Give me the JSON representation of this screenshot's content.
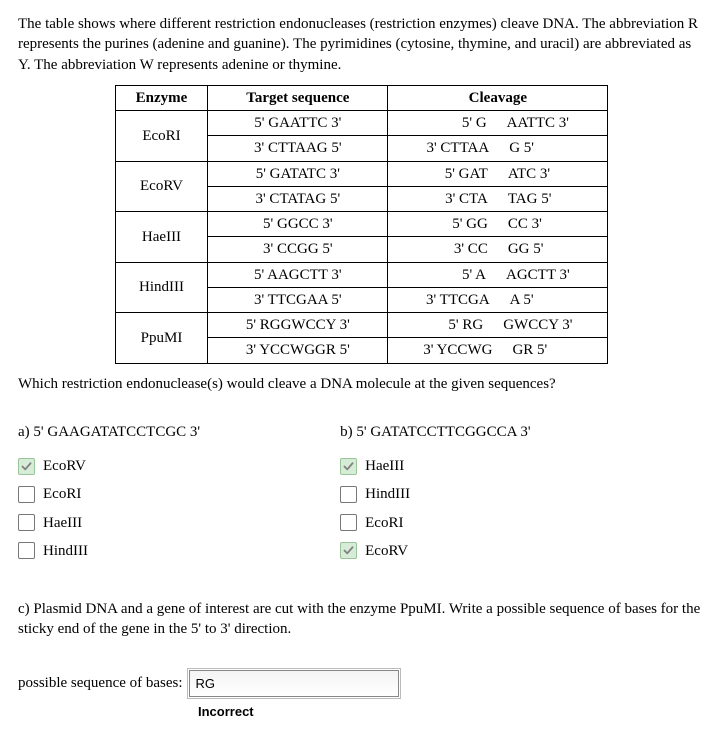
{
  "intro": "The table shows where different restriction endonucleases (restriction enzymes) cleave DNA. The abbreviation R represents the purines (adenine and guanine). The pyrimidines (cytosine, thymine, and uracil) are abbreviated as Y. The abbreviation W represents adenine or thymine.",
  "table": {
    "headers": {
      "enzyme": "Enzyme",
      "target": "Target sequence",
      "cleavage": "Cleavage"
    },
    "rows": [
      {
        "enzyme": "EcoRI",
        "target": [
          "5' GAATTC 3'",
          "3' CTTAAG 5'"
        ],
        "cleave": [
          [
            "5' G",
            "AATTC 3'"
          ],
          [
            "3' CTTAA",
            "G 5'"
          ]
        ]
      },
      {
        "enzyme": "EcoRV",
        "target": [
          "5' GATATC 3'",
          "3' CTATAG 5'"
        ],
        "cleave": [
          [
            "5' GAT",
            "ATC 3'"
          ],
          [
            "3' CTA",
            "TAG 5'"
          ]
        ]
      },
      {
        "enzyme": "HaeIII",
        "target": [
          "5' GGCC 3'",
          "3' CCGG 5'"
        ],
        "cleave": [
          [
            "5' GG",
            "CC 3'"
          ],
          [
            "3' CC",
            "GG 5'"
          ]
        ]
      },
      {
        "enzyme": "HindIII",
        "target": [
          "5' AAGCTT 3'",
          "3' TTCGAA 5'"
        ],
        "cleave": [
          [
            "5' A",
            "AGCTT 3'"
          ],
          [
            "3' TTCGA",
            "A 5'"
          ]
        ]
      },
      {
        "enzyme": "PpuMI",
        "target": [
          "5' RGGWCCY 3'",
          "3' YCCWGGR 5'"
        ],
        "cleave": [
          [
            "5' RG",
            "GWCCY 3'"
          ],
          [
            "3' YCCWG",
            "GR 5'"
          ]
        ]
      }
    ]
  },
  "question": "Which restriction endonuclease(s) would cleave a DNA molecule at the given sequences?",
  "parts": {
    "a": {
      "label": "a) 5' GAAGATATCCTCGC 3'",
      "options": [
        {
          "label": "EcoRV",
          "checked": true
        },
        {
          "label": "EcoRI",
          "checked": false
        },
        {
          "label": "HaeIII",
          "checked": false
        },
        {
          "label": "HindIII",
          "checked": false
        }
      ]
    },
    "b": {
      "label": "b) 5' GATATCCTTCGGCCA 3'",
      "options": [
        {
          "label": "HaeIII",
          "checked": true
        },
        {
          "label": "HindIII",
          "checked": false
        },
        {
          "label": "EcoRI",
          "checked": false
        },
        {
          "label": "EcoRV",
          "checked": true
        }
      ]
    }
  },
  "partc": {
    "text": "c) Plasmid DNA and a gene of interest are cut with the enzyme PpuMI. Write a possible sequence of bases for the sticky end of the gene in the 5' to 3' direction.",
    "field_label": "possible sequence of bases:",
    "value": "RG",
    "feedback": "Incorrect"
  }
}
